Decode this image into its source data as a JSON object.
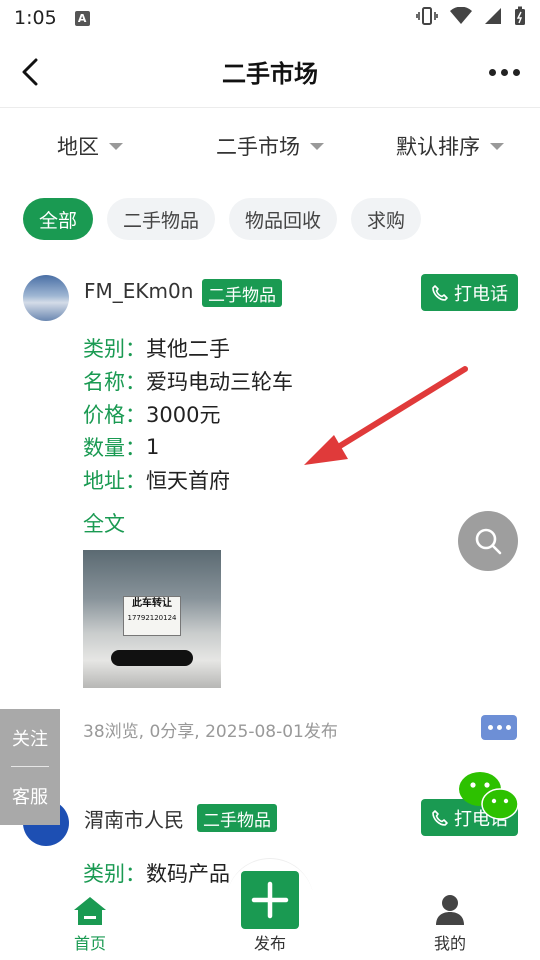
{
  "status_bar": {
    "time": "1:05",
    "notif_letter": "A"
  },
  "header": {
    "title": "二手市场"
  },
  "filters": [
    {
      "label": "地区"
    },
    {
      "label": "二手市场"
    },
    {
      "label": "默认排序"
    }
  ],
  "chips": [
    {
      "label": "全部",
      "active": true
    },
    {
      "label": "二手物品",
      "active": false
    },
    {
      "label": "物品回收",
      "active": false
    },
    {
      "label": "求购",
      "active": false
    }
  ],
  "posts": [
    {
      "username": "FM_EKm0n",
      "tag": "二手物品",
      "call_label": "打电话",
      "fields": [
        {
          "label": "类别：",
          "value": "其他二手"
        },
        {
          "label": "名称：",
          "value": "爱玛电动三轮车"
        },
        {
          "label": "价格：",
          "value": "3000元"
        },
        {
          "label": "数量：",
          "value": "1"
        },
        {
          "label": "地址：",
          "value": "恒天首府"
        }
      ],
      "fulltext_label": "全文",
      "photo_sign_text": "此车转让",
      "photo_sign_number": "17792120124",
      "meta": "38浏览, 0分享, 2025-08-01发布"
    },
    {
      "username": "渭南市人民",
      "tag": "二手物品",
      "call_label": "打电话",
      "fields": [
        {
          "label": "类别：",
          "value": "数码产品"
        }
      ]
    }
  ],
  "side_panel": {
    "follow": "关注",
    "service": "客服"
  },
  "bottom_nav": {
    "home": "首页",
    "publish": "发布",
    "mine": "我的"
  },
  "colors": {
    "accent": "#1a9a52",
    "arrow": "#e03a3a",
    "fab_gray": "#9e9e9e"
  }
}
